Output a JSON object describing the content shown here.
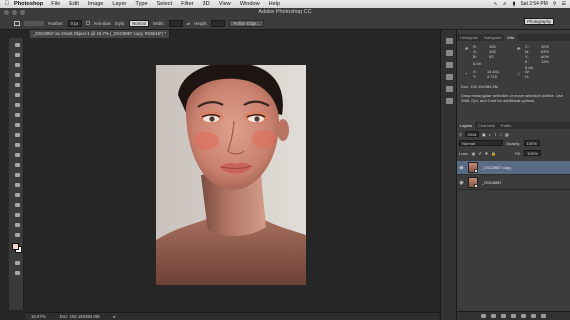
{
  "menubar": {
    "app_name": "Photoshop",
    "items": [
      "File",
      "Edit",
      "Image",
      "Layer",
      "Type",
      "Select",
      "Filter",
      "3D",
      "View",
      "Window",
      "Help"
    ],
    "clock": "Sat 2:54 PM"
  },
  "window": {
    "title": "Adobe Photoshop CC"
  },
  "options": {
    "feather_label": "Feather:",
    "feather_value": "0 px",
    "anti_alias_label": "Anti-alias",
    "style_label": "Style:",
    "style_value": "Normal",
    "width_label": "Width:",
    "height_label": "Height:",
    "refine_edge_label": "Refine Edge...",
    "workspace_value": "Photography"
  },
  "document": {
    "tab_label": "_DSC8957 as Smart Object-1 @ 16.7% (_DSC8957 copy, RGB/16*) *",
    "zoom": "16.67%",
    "doc_size": "Doc: 192.1M/384.0M"
  },
  "panels": {
    "top_tabs": [
      "Histogram",
      "Navigator",
      "Info"
    ],
    "top_active": "Info",
    "info": {
      "r_label": "R:",
      "r_value": "155",
      "g_label": "G:",
      "g_value": "105",
      "b_label": "B:",
      "b_value": "93",
      "c_label": "C:",
      "c_value": "30%",
      "m_label": "M:",
      "m_value": "63%",
      "y_label": "Y:",
      "y_value": "60%",
      "k_label": "K:",
      "k_value": "13%",
      "bit_left": "8-bit",
      "bit_right": "8-bit",
      "x_label": "X:",
      "x_value": "14.641",
      "y2_label": "Y:",
      "y2_value": "4.716",
      "w_label": "W:",
      "h_label": "H:",
      "doc": "Doc: 192.1M/384.0M",
      "hint": "Draw rectangular selection or move selection outline. Use Shift, Opt, and Cmd for additional options."
    },
    "layers_tabs": [
      "Layers",
      "Channels",
      "Paths"
    ],
    "layers_active": "Layers",
    "kind_label": "Kind",
    "blend_mode": "Normal",
    "opacity_label": "Opacity:",
    "opacity_value": "100%",
    "lock_label": "Lock:",
    "fill_label": "Fill:",
    "fill_value": "100%",
    "layers": [
      {
        "name": "_DSC8957 copy",
        "selected": true
      },
      {
        "name": "_DSC8957",
        "selected": false
      }
    ]
  },
  "colors": {
    "foreground": "#f1d6d0",
    "background": "#ffffff",
    "selection": "#5a6b85"
  }
}
